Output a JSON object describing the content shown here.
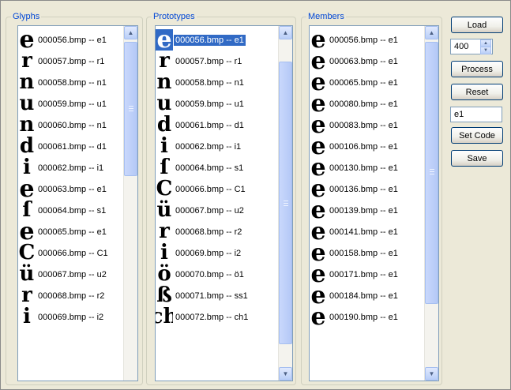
{
  "groups": {
    "glyphs": {
      "title": "Glyphs",
      "items": [
        {
          "glyph": "e",
          "label": "000056.bmp -- e1"
        },
        {
          "glyph": "r",
          "label": "000057.bmp -- r1"
        },
        {
          "glyph": "n",
          "label": "000058.bmp -- n1"
        },
        {
          "glyph": "u",
          "label": "000059.bmp -- u1"
        },
        {
          "glyph": "n",
          "label": "000060.bmp -- n1"
        },
        {
          "glyph": "d",
          "label": "000061.bmp -- d1"
        },
        {
          "glyph": "i",
          "label": "000062.bmp -- i1"
        },
        {
          "glyph": "e",
          "label": "000063.bmp -- e1"
        },
        {
          "glyph": "ſ",
          "label": "000064.bmp -- s1"
        },
        {
          "glyph": "e",
          "label": "000065.bmp -- e1"
        },
        {
          "glyph": "C",
          "label": "000066.bmp -- C1"
        },
        {
          "glyph": "ü",
          "label": "000067.bmp -- u2"
        },
        {
          "glyph": "r",
          "label": "000068.bmp -- r2"
        },
        {
          "glyph": "i",
          "label": "000069.bmp -- i2"
        }
      ]
    },
    "prototypes": {
      "title": "Prototypes",
      "items": [
        {
          "glyph": "e",
          "label": "000056.bmp -- e1",
          "selected": true
        },
        {
          "glyph": "r",
          "label": "000057.bmp -- r1"
        },
        {
          "glyph": "n",
          "label": "000058.bmp -- n1"
        },
        {
          "glyph": "u",
          "label": "000059.bmp -- u1"
        },
        {
          "glyph": "d",
          "label": "000061.bmp -- d1"
        },
        {
          "glyph": "i",
          "label": "000062.bmp -- i1"
        },
        {
          "glyph": "ſ",
          "label": "000064.bmp -- s1"
        },
        {
          "glyph": "C",
          "label": "000066.bmp -- C1"
        },
        {
          "glyph": "ü",
          "label": "000067.bmp -- u2"
        },
        {
          "glyph": "r",
          "label": "000068.bmp -- r2"
        },
        {
          "glyph": "i",
          "label": "000069.bmp -- i2"
        },
        {
          "glyph": "ö",
          "label": "000070.bmp -- ö1"
        },
        {
          "glyph": "ß",
          "label": "000071.bmp -- ss1"
        },
        {
          "glyph": "ch",
          "label": "000072.bmp -- ch1"
        }
      ]
    },
    "members": {
      "title": "Members",
      "items": [
        {
          "glyph": "e",
          "label": "000056.bmp -- e1"
        },
        {
          "glyph": "e",
          "label": "000063.bmp -- e1"
        },
        {
          "glyph": "e",
          "label": "000065.bmp -- e1"
        },
        {
          "glyph": "e",
          "label": "000080.bmp -- e1"
        },
        {
          "glyph": "e",
          "label": "000083.bmp -- e1"
        },
        {
          "glyph": "e",
          "label": "000106.bmp -- e1"
        },
        {
          "glyph": "e",
          "label": "000130.bmp -- e1"
        },
        {
          "glyph": "e",
          "label": "000136.bmp -- e1"
        },
        {
          "glyph": "e",
          "label": "000139.bmp -- e1"
        },
        {
          "glyph": "e",
          "label": "000141.bmp -- e1"
        },
        {
          "glyph": "e",
          "label": "000158.bmp -- e1"
        },
        {
          "glyph": "e",
          "label": "000171.bmp -- e1"
        },
        {
          "glyph": "e",
          "label": "000184.bmp -- e1"
        },
        {
          "glyph": "e",
          "label": "000190.bmp -- e1"
        }
      ]
    }
  },
  "controls": {
    "load_label": "Load",
    "spin_value": "400",
    "process_label": "Process",
    "reset_label": "Reset",
    "code_value": "e1",
    "set_code_label": "Set Code",
    "save_label": "Save"
  }
}
